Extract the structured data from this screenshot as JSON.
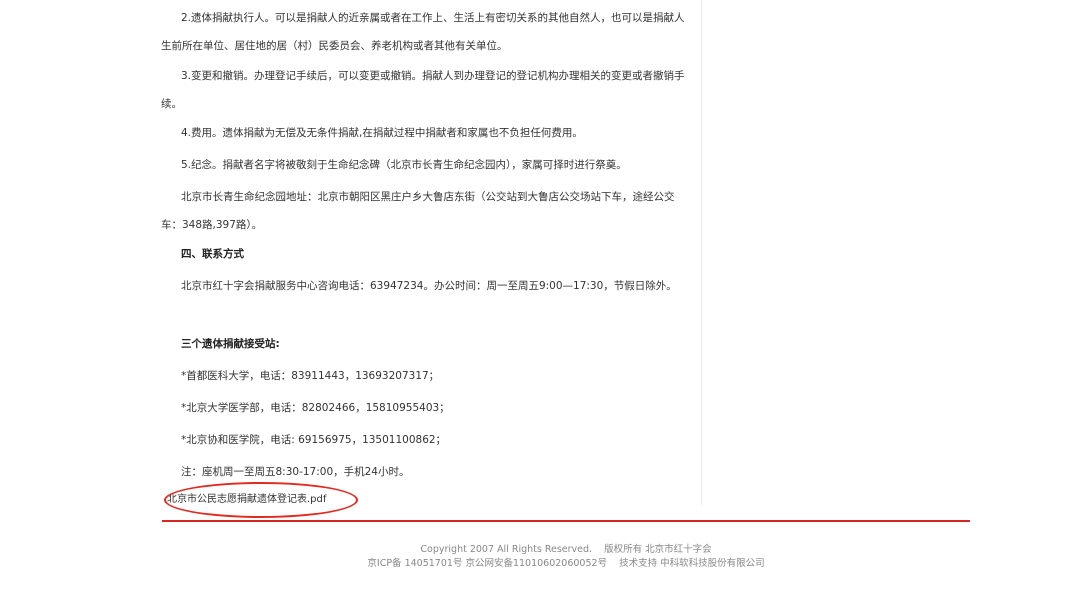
{
  "article": {
    "p1": "2.遗体捐献执行人。可以是捐献人的近亲属或者在工作上、生活上有密切关系的其他自然人，也可以是捐献人生前所在单位、居住地的居（村）民委员会、养老机构或者其他有关单位。",
    "p2": "3.变更和撤销。办理登记手续后，可以变更或撤销。捐献人到办理登记的登记机构办理相关的变更或者撤销手续。",
    "p3": "4.费用。遗体捐献为无偿及无条件捐献,在捐献过程中捐献者和家属也不负担任何费用。",
    "p4": "5.纪念。捐献者名字将被敬刻于生命纪念碑（北京市长青生命纪念园内），家属可择时进行祭奠。",
    "p5": "北京市长青生命纪念园地址：北京市朝阳区黑庄户乡大鲁店东街（公交站到大鲁店公交场站下车，途经公交车：348路,397路）。",
    "section_heading": "四、联系方式",
    "p6": "北京市红十字会捐献服务中心咨询电话：63947234。办公时间：周一至周五9:00—17:30，节假日除外。",
    "stations_heading": "三个遗体捐献接受站:",
    "station1": "*首都医科大学，电话：83911443，13693207317；",
    "station2": "*北京大学医学部，电话：82802466，15810955403；",
    "station3": "*北京协和医学院，电话: 69156975，13501100862；",
    "note": "注：座机周一至周五8:30-17:00，手机24小时。",
    "attachment": "北京市公民志愿捐献遗体登记表.pdf"
  },
  "footer": {
    "copyright": "Copyright 2007 All Rights Reserved.",
    "owner": "版权所有 北京市红十字会",
    "icp": "京ICP备 14051701号 京公网安备11010602060052号",
    "support": "技术支持 中科软科技股份有限公司"
  },
  "colors": {
    "accent_red": "#d7281f",
    "text": "#333333",
    "footer_text": "#888888"
  }
}
